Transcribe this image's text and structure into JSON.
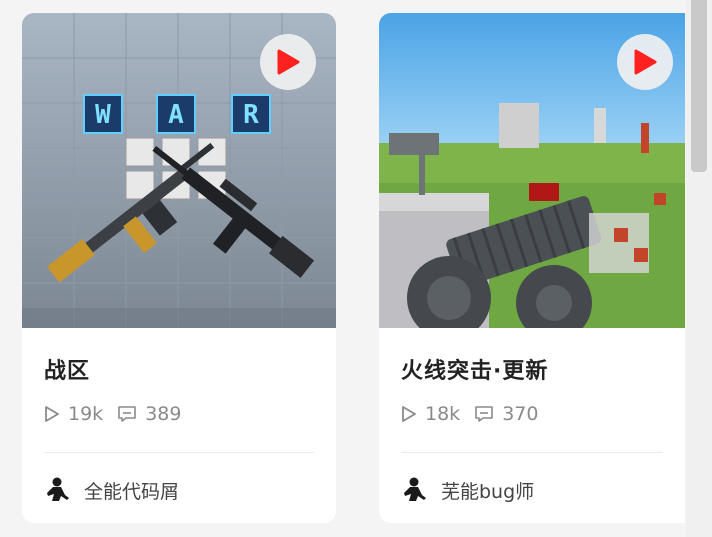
{
  "cards": [
    {
      "title": "战区",
      "plays": "19k",
      "comments": "389",
      "author": "全能代码屑",
      "thumb_letters": [
        "W",
        "A",
        "R"
      ]
    },
    {
      "title": "火线突击·更新",
      "plays": "18k",
      "comments": "370",
      "author": "芜能bug师"
    }
  ],
  "colors": {
    "play_red": "#ff2020",
    "title_text": "#222222",
    "meta_text": "#8a8a8a"
  },
  "icons": {
    "play_overlay": "play-icon",
    "views": "play-outline-icon",
    "comments": "comment-icon",
    "avatar": "user-avatar-icon"
  }
}
